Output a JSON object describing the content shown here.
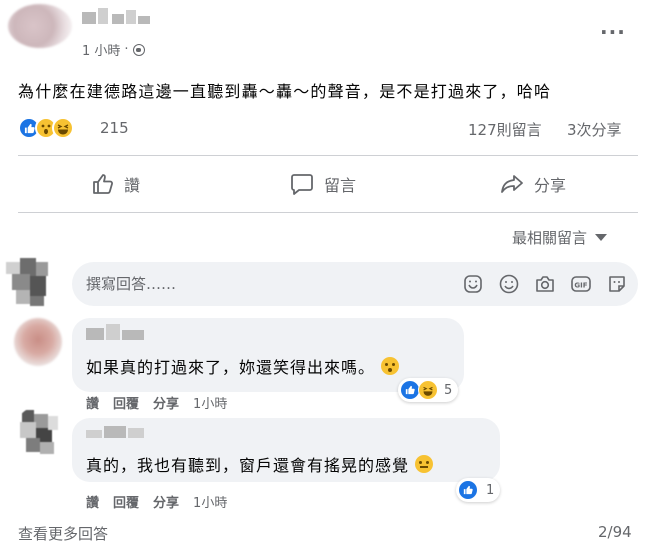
{
  "post": {
    "time": "1 小時",
    "text": "為什麼在建德路這邊一直聽到轟～轟～的聲音，是不是打過來了，哈哈",
    "reaction_count": "215",
    "comments_count": "127則留言",
    "shares_count": "3次分享",
    "more_icon": "ellipsis-icon",
    "privacy_icon": "globe-icon"
  },
  "actions": {
    "like": "讚",
    "comment": "留言",
    "share": "分享"
  },
  "sort": {
    "label": "最相關留言"
  },
  "composer": {
    "placeholder": "撰寫回答……",
    "icons": [
      "sticker-icon",
      "emoji-icon",
      "camera-icon",
      "gif-icon",
      "sticker-face-icon"
    ]
  },
  "comments": [
    {
      "text": "如果真的打過來了，妳還笑得出來嗎。",
      "emoji": "surprised-face",
      "reaction_count": "5",
      "reactions": [
        "like",
        "haha"
      ],
      "like_label": "讚",
      "reply_label": "回覆",
      "share_label": "分享",
      "time": "1小時"
    },
    {
      "text": "真的，我也有聽到，窗戶還會有搖晃的感覺",
      "emoji": "sleepy-face",
      "reaction_count": "1",
      "reactions": [
        "like"
      ],
      "like_label": "讚",
      "reply_label": "回覆",
      "share_label": "分享",
      "time": "1小時"
    }
  ],
  "footer": {
    "more_replies": "查看更多回答",
    "page_count": "2/94"
  },
  "colors": {
    "like_blue": "#1b74e4",
    "reaction_yellow": "#f7c232",
    "secondary_text": "#65676b",
    "bubble_bg": "#f0f2f5"
  }
}
